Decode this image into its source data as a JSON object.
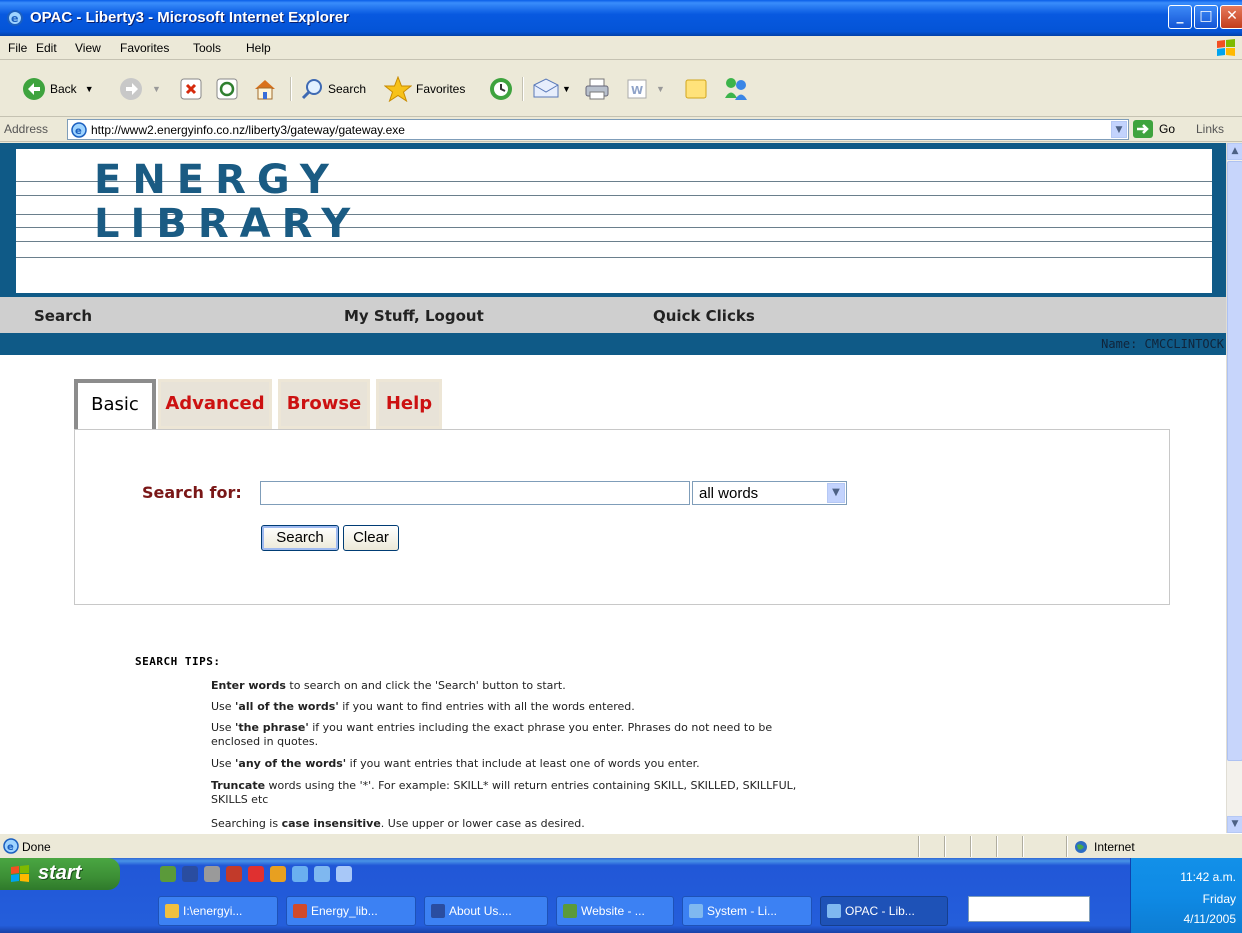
{
  "window": {
    "title": "OPAC - Liberty3 - Microsoft Internet Explorer",
    "min_label": "_",
    "max_label": "□",
    "close_label": "✕"
  },
  "menu": [
    "File",
    "Edit",
    "View",
    "Favorites",
    "Tools",
    "Help"
  ],
  "toolbar": {
    "back": "Back",
    "search": "Search",
    "favorites": "Favorites"
  },
  "address": {
    "label": "Address",
    "url": "http://www2.energyinfo.co.nz/liberty3/gateway/gateway.exe",
    "go": "Go",
    "links": "Links"
  },
  "page": {
    "logo_line1": "ENERGY",
    "logo_line2": "LIBRARY",
    "nav": {
      "search": "Search",
      "my_stuff": "My Stuff",
      "comma": ",",
      "logout": "Logout",
      "quick_clicks": "Quick Clicks"
    },
    "user_name": "Name: CMCCLINTOCK",
    "tabs": [
      "Basic",
      "Advanced",
      "Browse",
      "Help"
    ],
    "search_label": "Search for:",
    "search_value": "",
    "match_option": "all words",
    "search_button": "Search",
    "clear_button": "Clear",
    "tips_heading": "SEARCH TIPS:",
    "tips": [
      {
        "bold": "Enter words",
        "rest": " to search on and click the 'Search' button to start."
      },
      {
        "pre": "Use ",
        "bold": "'all of the words'",
        "rest": " if you want to find entries with all the words entered."
      },
      {
        "pre": "Use ",
        "bold": "'the phrase'",
        "rest": " if you want entries including the exact phrase you enter. Phrases do not need to be enclosed in quotes."
      },
      {
        "pre": "Use ",
        "bold": "'any of the words'",
        "rest": " if you want entries that include at least one of words you enter."
      },
      {
        "bold": "Truncate",
        "rest": " words using the '*'. For example: SKILL* will return entries containing SKILL, SKILLED, SKILLFUL, SKILLS etc"
      },
      {
        "pre": "Searching is ",
        "bold": "case insensitive",
        "rest": ". Use upper or lower case as desired."
      }
    ]
  },
  "status": {
    "text": "Done",
    "zone": "Internet"
  },
  "taskbar": {
    "start": "start",
    "tasks": [
      "I:\\energyi...",
      "Energy_lib...",
      "About Us....",
      "Website - ...",
      "System - Li...",
      "OPAC - Lib..."
    ],
    "time": "11:42 a.m.",
    "day": "Friday",
    "date": "4/11/2005"
  },
  "colors": {
    "banner": "#0f5a87",
    "logo": "#1a5b83",
    "tab_text": "#cc1111",
    "search_label": "#7a1717"
  }
}
